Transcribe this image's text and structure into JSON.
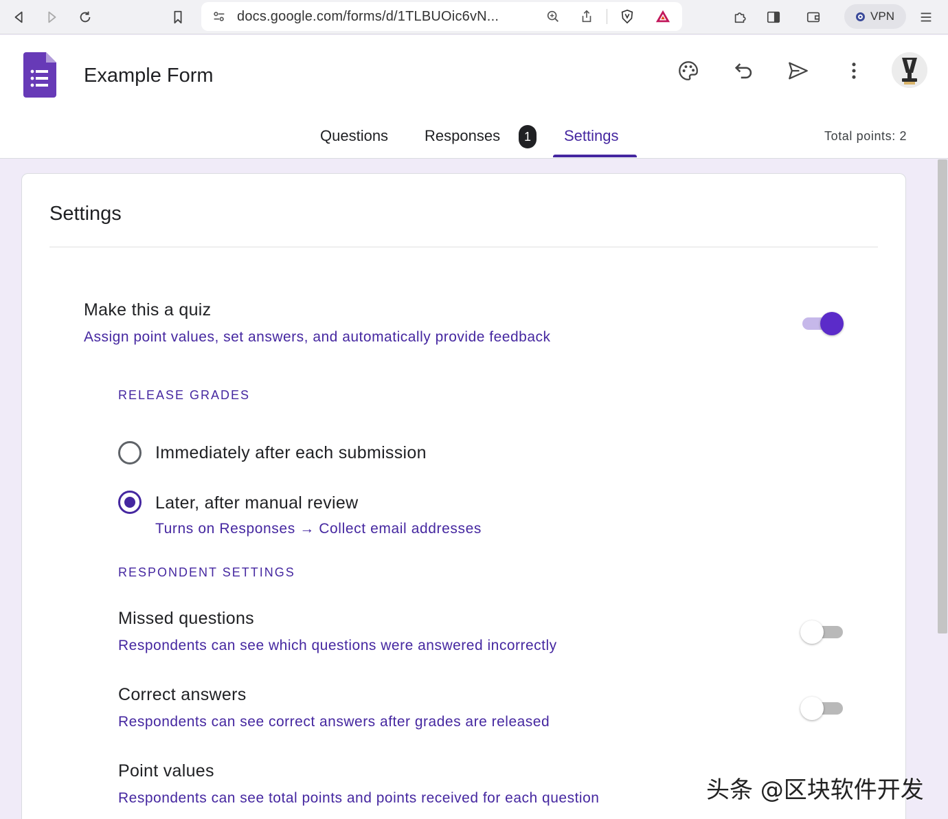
{
  "browser": {
    "url": "docs.google.com/forms/d/1TLBUOic6vN...",
    "vpn_label": "VPN"
  },
  "header": {
    "form_title": "Example Form"
  },
  "tabs": [
    {
      "label": "Questions"
    },
    {
      "label": "Responses",
      "badge": "1"
    },
    {
      "label": "Settings"
    }
  ],
  "total_points": "Total points: 2",
  "settings": {
    "title": "Settings",
    "quiz": {
      "title": "Make this a quiz",
      "description": "Assign point values, set answers, and automatically provide feedback",
      "enabled": true
    },
    "release_grades": {
      "heading": "RELEASE GRADES",
      "options": [
        {
          "label": "Immediately after each submission",
          "selected": false
        },
        {
          "label": "Later, after manual review",
          "sublabel": "Turns on Responses → Collect email addresses",
          "selected": true
        }
      ]
    },
    "respondent_settings": {
      "heading": "RESPONDENT SETTINGS",
      "items": [
        {
          "title": "Missed questions",
          "description": "Respondents can see which questions were answered incorrectly",
          "enabled": false
        },
        {
          "title": "Correct answers",
          "description": "Respondents can see correct answers after grades are released",
          "enabled": false
        },
        {
          "title": "Point values",
          "description": "Respondents can see total points and points received for each question"
        }
      ]
    }
  },
  "watermark": "头条 @区块软件开发",
  "colors": {
    "accent": "#4527a0",
    "toggle_on": "#5b2bc9",
    "forms_brand": "#673ab7"
  }
}
